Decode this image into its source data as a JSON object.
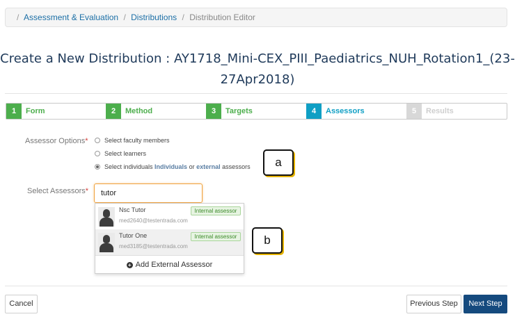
{
  "breadcrumb": {
    "items": [
      "Assessment & Evaluation",
      "Distributions",
      "Distribution Editor"
    ]
  },
  "page": {
    "title_line1": "Create a New Distribution : AY1718_Mini-CEX_PIII_Paediatrics_NUH_Rotation1_(23-",
    "title_line2": "27Apr2018)"
  },
  "steps": [
    {
      "num": "1",
      "label": "Form",
      "state": "done"
    },
    {
      "num": "2",
      "label": "Method",
      "state": "done"
    },
    {
      "num": "3",
      "label": "Targets",
      "state": "done"
    },
    {
      "num": "4",
      "label": "Assessors",
      "state": "active"
    },
    {
      "num": "5",
      "label": "Results",
      "state": "pending"
    }
  ],
  "assessor_options": {
    "label": "Assessor Options",
    "required_mark": "*",
    "options": [
      {
        "text": "Select faculty members",
        "selected": false
      },
      {
        "text": "Select learners",
        "selected": false
      },
      {
        "pre": "Select individuals ",
        "bold1": "Individuals",
        "mid": " or ",
        "bold2": "external",
        "post": " assessors",
        "selected": true
      }
    ]
  },
  "select_assessors": {
    "label": "Select Assessors",
    "required_mark": "*",
    "search_value": "tutor",
    "results": [
      {
        "name": "Nsc Tutor",
        "email": "med2640@testentrada.com",
        "badge": "Internal assessor"
      },
      {
        "name": "Tutor One",
        "email": "med3185@testentrada.com",
        "badge": "Internal assessor"
      }
    ],
    "add_external_label": "Add External Assessor",
    "add_external_icon": "plus-circle-icon"
  },
  "callouts": {
    "a": "a",
    "b": "b"
  },
  "footer": {
    "cancel_label": "Cancel",
    "previous_label": "Previous Step",
    "next_label": "Next Step"
  },
  "colors": {
    "done": "#4cae4c",
    "active": "#0f9fc4",
    "pending": "#d8d8d8",
    "primary_button": "#154a7e",
    "search_focus": "#f0a23c"
  }
}
